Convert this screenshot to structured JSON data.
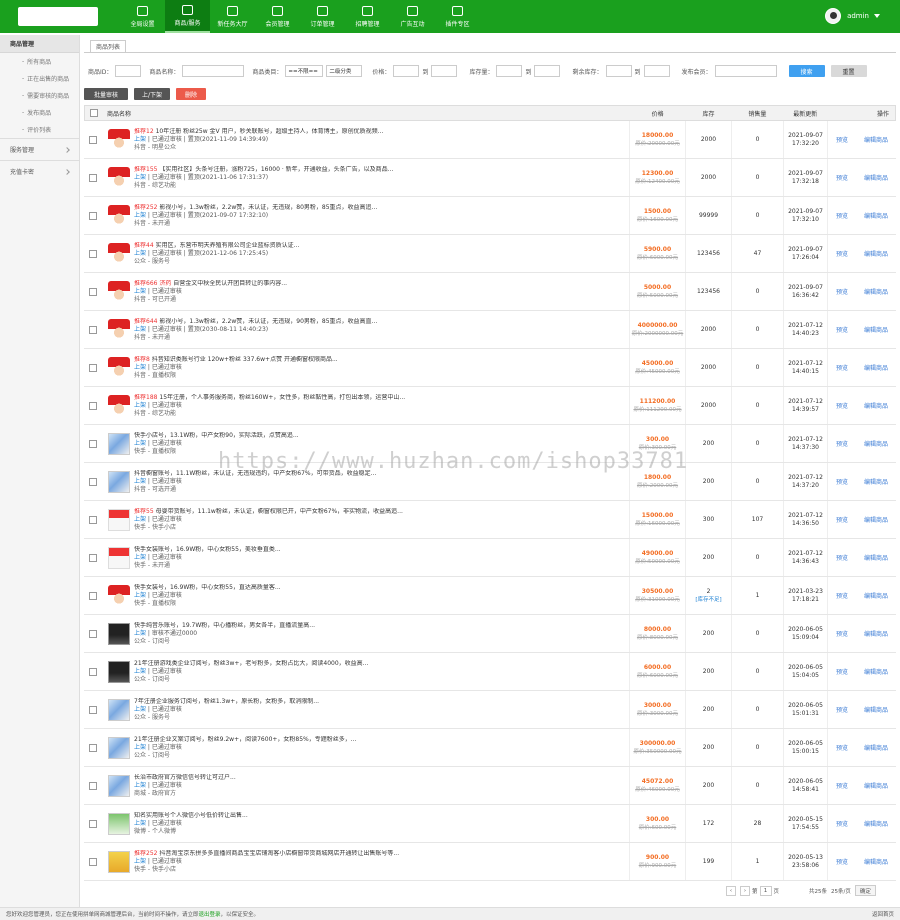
{
  "nav": {
    "items": [
      {
        "label": "全局设置"
      },
      {
        "label": "商品/服务",
        "active": true
      },
      {
        "label": "新任务大厅"
      },
      {
        "label": "会员管理"
      },
      {
        "label": "订单管理"
      },
      {
        "label": "招聘管理"
      },
      {
        "label": "广告互动"
      },
      {
        "label": "插件专区"
      }
    ]
  },
  "user": {
    "name": "admin"
  },
  "sidebar": {
    "section": "商品管理",
    "items": [
      "所有商品",
      "正在出售的商品",
      "需要审核的商品",
      "发布商品",
      "评价列表"
    ],
    "groups": [
      "服务管理",
      "充值卡密"
    ]
  },
  "tab": {
    "label": "商品列表"
  },
  "filters": {
    "id_label": "商品ID：",
    "name_label": "商品名称：",
    "cat_label": "商品类目：",
    "cat1": "==不限==",
    "cat2": "二级分类",
    "price_label": "价格：",
    "stock_label": "库存量：",
    "sold_label": "剩余库存：",
    "to": "到",
    "member_label": "发布会员：",
    "search_btn": "搜索",
    "reset_btn": "重置"
  },
  "actions": {
    "approve": "批量审核",
    "toggle": "上/下架",
    "delete": "删除"
  },
  "table": {
    "headers": {
      "name": "商品名称",
      "price": "价格",
      "stock": "库存",
      "sold": "销售量",
      "time": "最新更新",
      "ops": "操作"
    },
    "rows": [
      {
        "thumb": "cap",
        "tag": "推荐12",
        "title": "10年注册 粉丝25w 金V 用户，秒关联账号，超级主持人，体育博主，原创优质视频...",
        "status": "上架",
        "status2": "已通过审核",
        "extra": "置顶(2021-11-09 14:39:49)",
        "cat": "抖音 - 明星公众",
        "price": "18000.00",
        "orig": "原价:20000.00元",
        "stock": "2000",
        "sold": "0",
        "date": "2021-09-07",
        "time": "17:32:20",
        "op1": "预览",
        "op2": "编辑商品"
      },
      {
        "thumb": "cap",
        "tag": "推荐155",
        "title": "【实用社区】头条号注册，涨粉725，16000 · 新年，开通收益，头条广告，以及商品...",
        "status": "上架",
        "status2": "已通过审核",
        "extra": "置顶(2021-11-06 17:31:37)",
        "cat": "抖音 - 综艺功能",
        "price": "12300.00",
        "orig": "原价:12400.00元",
        "stock": "2000",
        "sold": "0",
        "date": "2021-09-07",
        "time": "17:32:18",
        "op1": "预览",
        "op2": "编辑商品"
      },
      {
        "thumb": "cap",
        "tag": "推荐252",
        "title": "影视小号，1.3w粉丝，2.2w赞，未认证，无违规，80男粉，85重点，收益高追...",
        "status": "上架",
        "status2": "已通过审核",
        "extra": "置顶(2021-09-07 17:32:10)",
        "cat": "抖音 - 未开通",
        "price": "1500.00",
        "orig": "原价:1600.00元",
        "stock": "99999",
        "sold": "0",
        "date": "2021-09-07",
        "time": "17:32:10",
        "op1": "预览",
        "op2": "编辑商品"
      },
      {
        "thumb": "cap",
        "tag": "推荐44",
        "title": "实用区，东营市明天养殖有限公司企业蓝标资质认证...",
        "status": "上架",
        "status2": "已通过审核",
        "extra": "置顶(2021-12-06 17:25:45)",
        "cat": "公众 - 服务号",
        "price": "5900.00",
        "orig": "原价:6000.00元",
        "stock": "123456",
        "sold": "47",
        "date": "2021-09-07",
        "time": "17:26:04",
        "op1": "预览",
        "op2": "编辑商品"
      },
      {
        "thumb": "cap",
        "tag": "推荐666 济药",
        "title": "自营金文中秋全民认开团目转让的事内容...",
        "status": "上架",
        "status2": "已通过审核",
        "extra": "",
        "cat": "抖音 - 可已开通",
        "price": "5000.00",
        "orig": "原价:5000.00元",
        "stock": "123456",
        "sold": "0",
        "date": "2021-09-07",
        "time": "16:36:42",
        "op1": "预览",
        "op2": "编辑商品"
      },
      {
        "thumb": "cap",
        "tag": "推荐644",
        "title": "影视小号，1.3w粉丝，2.2w赞，未认证，无违规，90男粉，85重点，收益高直...",
        "status": "上架",
        "status2": "已通过审核",
        "extra": "置顶(2030-08-11 14:40:23)",
        "cat": "抖音 - 未开通",
        "price": "4000000.00",
        "orig": "原价:2000000.00元",
        "stock": "2000",
        "sold": "0",
        "date": "2021-07-12",
        "time": "14:40:23",
        "op1": "预览",
        "op2": "编辑商品"
      },
      {
        "thumb": "cap",
        "tag": "推荐8",
        "title": "抖音知识类账号行业 120w+粉丝 337.6w+点赞 开通橱窗权限商品...",
        "status": "上架",
        "status2": "已通过审核",
        "extra": "",
        "cat": "抖音 - 直播权限",
        "price": "45000.00",
        "orig": "原价:45000.00元",
        "stock": "2000",
        "sold": "0",
        "date": "2021-07-12",
        "time": "14:40:15",
        "op1": "预览",
        "op2": "编辑商品"
      },
      {
        "thumb": "cap",
        "tag": "推荐188",
        "title": "15年注册，个人事务服务商，粉丝160W+，女性多，粉丝黏性高，打包出本领，运营中山...",
        "status": "上架",
        "status2": "已通过审核",
        "extra": "",
        "cat": "抖音 - 综艺功能",
        "price": "111200.00",
        "orig": "原价:111200.00元",
        "stock": "2000",
        "sold": "0",
        "date": "2021-07-12",
        "time": "14:39:57",
        "op1": "预览",
        "op2": "编辑商品"
      },
      {
        "thumb": "shot",
        "tag": "",
        "title": "快手小店号，13.1W粉，中产女粉90，实际活跃，点赞高追...",
        "status": "上架",
        "status2": "已通过审核",
        "extra": "",
        "cat": "快手 - 直播权限",
        "price": "300.00",
        "orig": "原价:300.00元",
        "stock": "200",
        "sold": "0",
        "date": "2021-07-12",
        "time": "14:37:30",
        "op1": "预览",
        "op2": "编辑商品"
      },
      {
        "thumb": "shot",
        "tag": "",
        "title": "抖音橱窗账号，11.1W粉丝，未认证，无违规违约，中产女粉67%，可带货品，收益稳定...",
        "status": "上架",
        "status2": "已通过审核",
        "extra": "",
        "cat": "抖音 - 可选开通",
        "price": "1800.00",
        "orig": "原价:2000.00元",
        "stock": "200",
        "sold": "0",
        "date": "2021-07-12",
        "time": "14:37:20",
        "op1": "预览",
        "op2": "编辑商品"
      },
      {
        "thumb": "red",
        "tag": "推荐55",
        "title": "母婴带货账号，11.1w粉丝，未认证，橱窗权限已开，中产女粉67%，非实物流，收益高追...",
        "status": "上架",
        "status2": "已通过审核",
        "extra": "",
        "cat": "快手 - 快手小店",
        "price": "15000.00",
        "orig": "原价:16000.00元",
        "stock": "300",
        "sold": "107",
        "date": "2021-07-12",
        "time": "14:36:50",
        "op1": "预览",
        "op2": "编辑商品"
      },
      {
        "thumb": "red",
        "tag": "",
        "title": "快手女装账号，16.9W粉，中心女粉55，美妆垂直类...",
        "status": "上架",
        "status2": "已通过审核",
        "extra": "",
        "cat": "快手 - 未开通",
        "price": "49000.00",
        "orig": "原价:50000.00元",
        "stock": "200",
        "sold": "0",
        "date": "2021-07-12",
        "time": "14:36:43",
        "op1": "预览",
        "op2": "编辑商品"
      },
      {
        "thumb": "cap",
        "tag": "",
        "title": "快手女装号，16.9W粉，中心女粉55，直达高质量客...",
        "status": "上架",
        "status2": "已通过审核",
        "extra": "",
        "cat": "快手 - 直播权限",
        "price": "30500.00",
        "orig": "原价:31000.00元",
        "stock": "2",
        "stock_badge": "[库存不足]",
        "sold": "1",
        "date": "2021-03-23",
        "time": "17:18:21",
        "op1": "预览",
        "op2": "编辑商品"
      },
      {
        "thumb": "dark",
        "tag": "",
        "title": "快手纯音乐账号，19.7W粉，中心播粉丝，男女各半，直播流量高...",
        "status": "上架",
        "status2": "审核不通过0000",
        "extra": "",
        "cat": "公众 - 订阅号",
        "price": "8000.00",
        "orig": "原价:8000.00元",
        "stock": "200",
        "sold": "0",
        "date": "2020-06-05",
        "time": "15:09:04",
        "op1": "预览",
        "op2": "编辑商品"
      },
      {
        "thumb": "dark",
        "tag": "",
        "title": "21年注册游戏类企业订阅号，粉丝3w+，老号粉多，女粉占比大，阅读4000，收益高...",
        "status": "上架",
        "status2": "已通过审核",
        "extra": "",
        "cat": "公众 - 订阅号",
        "price": "6000.00",
        "orig": "原价:6000.00元",
        "stock": "200",
        "sold": "0",
        "date": "2020-06-05",
        "time": "15:04:05",
        "op1": "预览",
        "op2": "编辑商品"
      },
      {
        "thumb": "shot",
        "tag": "",
        "title": "7年注册企业服务订阅号，粉丝1.3w+，原长粉，女粉多，取消限制...",
        "status": "上架",
        "status2": "已通过审核",
        "extra": "",
        "cat": "公众 - 服务号",
        "price": "3000.00",
        "orig": "原价:3000.00元",
        "stock": "200",
        "sold": "0",
        "date": "2020-06-05",
        "time": "15:01:31",
        "op1": "预览",
        "op2": "编辑商品"
      },
      {
        "thumb": "shot",
        "tag": "",
        "title": "21年注册企业文案订阅号，粉丝9.2w+，阅读7600+，女粉85%，专题粉丝多，...",
        "status": "上架",
        "status2": "已通过审核",
        "extra": "",
        "cat": "公众 - 订阅号",
        "price": "300000.00",
        "orig": "原价:350000.00元",
        "stock": "200",
        "sold": "0",
        "date": "2020-06-05",
        "time": "15:00:15",
        "op1": "预览",
        "op2": "编辑商品"
      },
      {
        "thumb": "shot",
        "tag": "",
        "title": "长治市政府官方微信信号转让可过户...",
        "status": "上架",
        "status2": "已通过审核",
        "extra": "",
        "cat": "商城 - 政府官方",
        "price": "45072.00",
        "orig": "原价:46000.00元",
        "stock": "200",
        "sold": "0",
        "date": "2020-06-05",
        "time": "14:58:41",
        "op1": "预览",
        "op2": "编辑商品"
      },
      {
        "thumb": "green",
        "tag": "",
        "title": "知名实用账号个人微信小号低价转让出售...",
        "status": "上架",
        "status2": "已通过审核",
        "extra": "",
        "cat": "微博 - 个人微博",
        "price": "300.00",
        "orig": "原价:600.00元",
        "stock": "172",
        "sold": "28",
        "date": "2020-05-15",
        "time": "17:54:55",
        "op1": "预览",
        "op2": "编辑商品"
      },
      {
        "thumb": "yellow",
        "tag": "推荐252",
        "title": "抖音淘宝京东拼多多直播间商品宝宝店铺淘客小店橱窗带货商城网店开通转让出售账号等...",
        "status": "上架",
        "status2": "已通过审核",
        "extra": "",
        "cat": "快手 - 快手小店",
        "price": "900.00",
        "orig": "原价:900.00元",
        "stock": "199",
        "sold": "1",
        "date": "2020-05-13",
        "time": "23:58:06",
        "op1": "预览",
        "op2": "编辑商品"
      }
    ]
  },
  "pager": {
    "prev": "‹",
    "page_label": "第",
    "current": "1",
    "page_suffix": "页",
    "total": "共25条",
    "per_page": "25条/页",
    "go": "确定"
  },
  "footer": {
    "left_prefix": "您好欢迎您管理员，您正在使用拼单网商城管理后台，当前时间不操作，请立即",
    "left_link": "退出登录",
    "left_suffix": "，以保证安全。",
    "right": "返回首页"
  },
  "watermark": "https://www.huzhan.com/ishop33781",
  "colors": {
    "brand_green": "#1aa01e",
    "price_orange": "#f36c21",
    "tag_red": "#e33",
    "link_blue": "#3a7bd5"
  }
}
